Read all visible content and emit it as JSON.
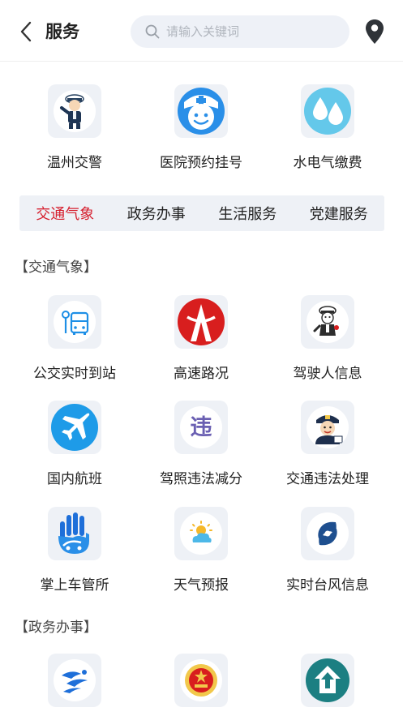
{
  "header": {
    "title": "服务",
    "search_placeholder": "请输入关键词"
  },
  "quick": [
    {
      "label": "温州交警",
      "icon": "traffic-police-icon"
    },
    {
      "label": "医院预约挂号",
      "icon": "nurse-icon"
    },
    {
      "label": "水电气缴费",
      "icon": "water-drops-icon"
    }
  ],
  "tabs": [
    {
      "label": "交通气象",
      "active": true
    },
    {
      "label": "政务办事",
      "active": false
    },
    {
      "label": "生活服务",
      "active": false
    },
    {
      "label": "党建服务",
      "active": false
    }
  ],
  "sections": [
    {
      "title": "【交通气象】",
      "items": [
        {
          "label": "公交实时到站",
          "icon": "bus-stop-icon"
        },
        {
          "label": "高速路况",
          "icon": "highway-logo-icon"
        },
        {
          "label": "驾驶人信息",
          "icon": "police-cartoon-icon"
        },
        {
          "label": "国内航班",
          "icon": "airplane-icon"
        },
        {
          "label": "驾照违法减分",
          "icon": "violation-char-icon",
          "glyph": "违"
        },
        {
          "label": "交通违法处理",
          "icon": "police-officer-icon"
        },
        {
          "label": "掌上车管所",
          "icon": "hand-car-icon"
        },
        {
          "label": "天气预报",
          "icon": "weather-icon"
        },
        {
          "label": "实时台风信息",
          "icon": "typhoon-icon"
        }
      ]
    },
    {
      "title": "【政务办事】",
      "items": [
        {
          "label": "",
          "icon": "runner-logo-icon"
        },
        {
          "label": "",
          "icon": "court-emblem-icon"
        },
        {
          "label": "",
          "icon": "housing-fund-icon"
        }
      ]
    }
  ],
  "colors": {
    "accent": "#d6202f",
    "tile_bg": "#eef1f6",
    "blue": "#1e8fe6"
  }
}
